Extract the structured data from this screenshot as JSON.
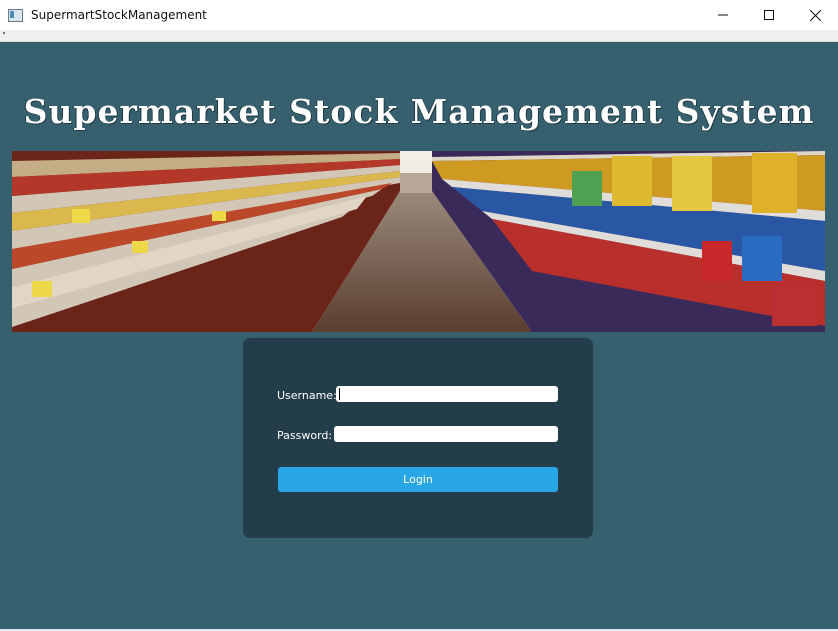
{
  "window": {
    "title": "SupermartStockManagement",
    "controls": [
      "minimize-icon",
      "maximize-icon",
      "close-icon"
    ]
  },
  "header": {
    "title": "Supermarket Stock Management System"
  },
  "banner": {
    "image": "supermarket aisle photo"
  },
  "login": {
    "username_label": "Username:",
    "username_value": "",
    "password_label": "Password:",
    "password_value": "",
    "login_label": "Login"
  },
  "colors": {
    "background": "#37606e",
    "panel": "#233e4a",
    "button": "#29a6e6"
  }
}
